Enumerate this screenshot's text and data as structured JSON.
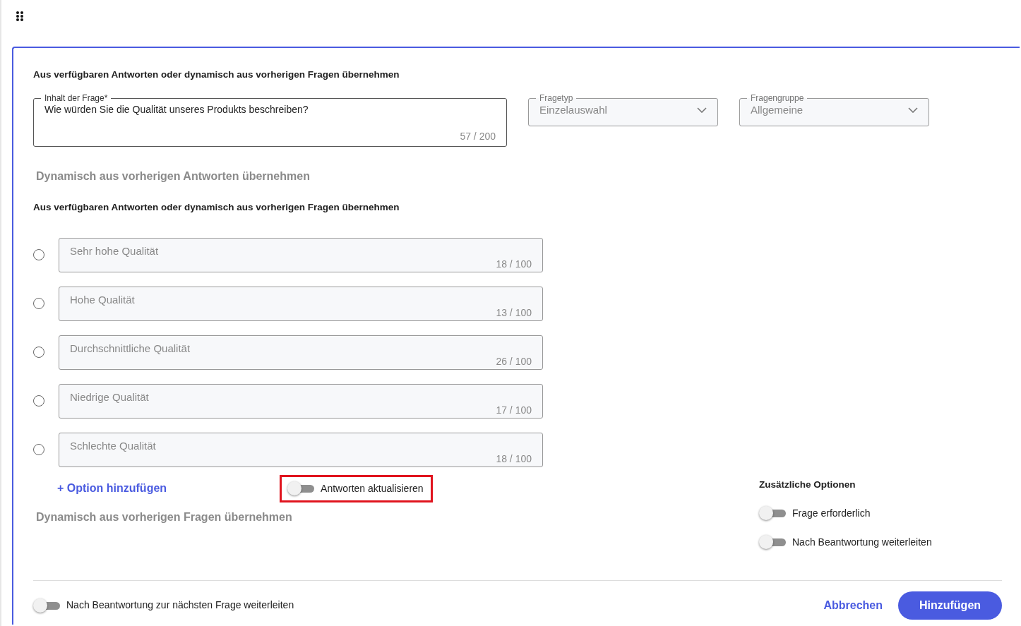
{
  "section_title": "Aus verfügbaren Antworten oder dynamisch aus vorherigen Fragen übernehmen",
  "question_field": {
    "label": "Inhalt der Frage*",
    "value": "Wie würden Sie die Qualität unseres Produkts beschreiben?",
    "counter": "57 / 200"
  },
  "selects": [
    {
      "label": "Fragetyp",
      "value": "Einzelauswahl",
      "disabled": true
    },
    {
      "label": "Fragengruppe",
      "value": "Allgemeine",
      "disabled": true
    }
  ],
  "dynamic_answers_heading": "Dynamisch aus vorherigen Antworten übernehmen",
  "answers_title": "Aus verfügbaren Antworten oder dynamisch aus vorherigen Fragen übernehmen",
  "options": [
    {
      "value": "Sehr hohe Qualität",
      "counter": "18 / 100",
      "selected": false,
      "disabled": true
    },
    {
      "value": "Hohe Qualität",
      "counter": "13 / 100",
      "selected": false,
      "disabled": true
    },
    {
      "value": "Durchschnittliche Qualität",
      "counter": "26 / 100",
      "selected": false,
      "disabled": true
    },
    {
      "value": "Niedrige Qualität",
      "counter": "17 / 100",
      "selected": false,
      "disabled": true
    },
    {
      "value": "Schlechte Qualität",
      "counter": "18 / 100",
      "selected": false,
      "disabled": true
    }
  ],
  "add_option": "+ Option hinzufügen",
  "update_toggle": {
    "label": "Antworten aktualisieren",
    "on": false,
    "highlighted": true
  },
  "dynamic_questions_heading": "Dynamisch aus vorherigen Fragen übernehmen",
  "additional_options": {
    "title": "Zusätzliche Optionen",
    "toggles": [
      {
        "label": "Frage erforderlich",
        "on": false
      },
      {
        "label": "Nach Beantwortung weiterleiten",
        "on": false
      }
    ]
  },
  "footer_toggle": {
    "label": "Nach Beantwortung zur nächsten Frage weiterleiten",
    "on": false
  },
  "buttons": {
    "cancel": "Abbrechen",
    "submit": "Hinzufügen"
  }
}
